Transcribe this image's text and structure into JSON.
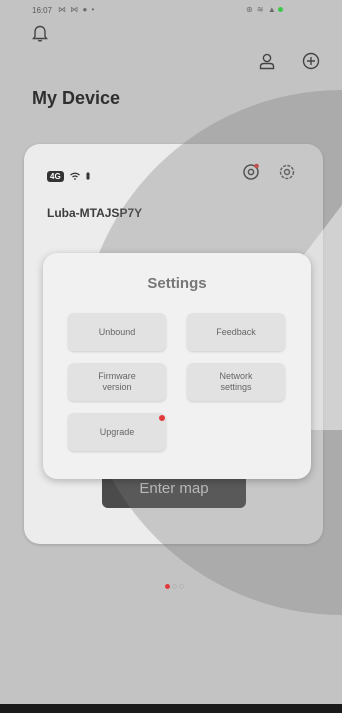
{
  "status_bar": {
    "time": "16:07",
    "left_icons": "⋈ ⋈ ● •",
    "right_icons": "⊛ ≋ ▲"
  },
  "header": {
    "title": "My Device"
  },
  "device": {
    "network_label": "4G",
    "name": "Luba-MTAJSP7Y",
    "enter_map_label": "Enter map"
  },
  "settings": {
    "title": "Settings",
    "unbound_label": "Unbound",
    "feedback_label": "Feedback",
    "firmware_label_line1": "Firmware",
    "firmware_label_line2": "version",
    "network_label_line1": "Network",
    "network_label_line2": "settings",
    "upgrade_label": "Upgrade"
  },
  "pager": {
    "pages": 3,
    "active": 1
  },
  "colors": {
    "accent_red": "#e23b3b",
    "battery_green": "#3cc94a",
    "button_dark": "#4b4b4b"
  }
}
